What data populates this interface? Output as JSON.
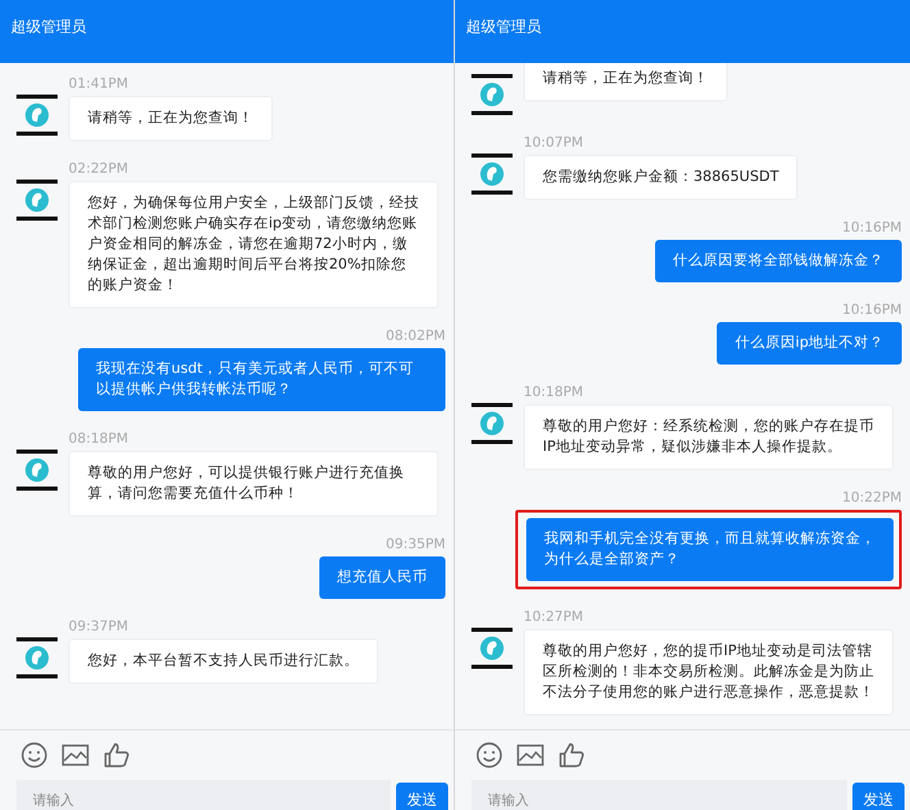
{
  "panels": [
    {
      "title": "超级管理员",
      "messages": [
        {
          "kind": "incoming",
          "time": "01:41PM",
          "text": "请稍等，正在为您查询！",
          "highlighted": false
        },
        {
          "kind": "incoming",
          "time": "02:22PM",
          "text": "您好，为确保每位用户安全，上级部门反馈，经技术部门检测您账户确实存在ip变动，请您缴纳您账户资金相同的解冻金，请您在逾期72小时内，缴纳保证金，超出逾期时间后平台将按20%扣除您的账户资金！",
          "highlighted": false
        },
        {
          "kind": "outgoing",
          "time": "08:02PM",
          "text": "我现在没有usdt，只有美元或者人民币，可不可以提供帐户供我转帐法币呢？",
          "highlighted": false
        },
        {
          "kind": "incoming",
          "time": "08:18PM",
          "text": "尊敬的用户您好，可以提供银行账户进行充值换算，请问您需要充值什么币种！",
          "highlighted": false
        },
        {
          "kind": "outgoing",
          "time": "09:35PM",
          "text": "想充值人民币",
          "highlighted": false
        },
        {
          "kind": "incoming",
          "time": "09:37PM",
          "text": "您好，本平台暂不支持人民币进行汇款。",
          "highlighted": false
        }
      ],
      "input": {
        "placeholder": "请输入"
      },
      "send_button": "发送"
    },
    {
      "title": "超级管理员",
      "messages": [
        {
          "kind": "incoming",
          "text": "请稍等，正在为您查询！",
          "highlighted": false
        },
        {
          "kind": "incoming",
          "time": "10:07PM",
          "text": "您需缴纳您账户金额：38865USDT",
          "highlighted": false
        },
        {
          "kind": "outgoing",
          "time": "10:16PM",
          "text": "什么原因要将全部钱做解冻金？",
          "highlighted": false
        },
        {
          "kind": "outgoing",
          "time": "10:16PM",
          "text": "什么原因ip地址不对？",
          "highlighted": false
        },
        {
          "kind": "incoming",
          "time": "10:18PM",
          "text": "尊敬的用户您好：经系统检测，您的账户存在提币IP地址变动异常，疑似涉嫌非本人操作提款。",
          "highlighted": false
        },
        {
          "kind": "outgoing",
          "time": "10:22PM",
          "text": "我网和手机完全没有更换，而且就算收解冻资金，为什么是全部资产？",
          "highlighted": true
        },
        {
          "kind": "incoming",
          "time": "10:27PM",
          "text": "尊敬的用户您好，您的提币IP地址变动是司法管辖区所检测的！非本交易所检测。此解冻金是为防止不法分子使用您的账户进行恶意操作，恶意提款！",
          "highlighted": false
        }
      ],
      "input": {
        "placeholder": "请输入"
      },
      "send_button": "发送"
    }
  ]
}
